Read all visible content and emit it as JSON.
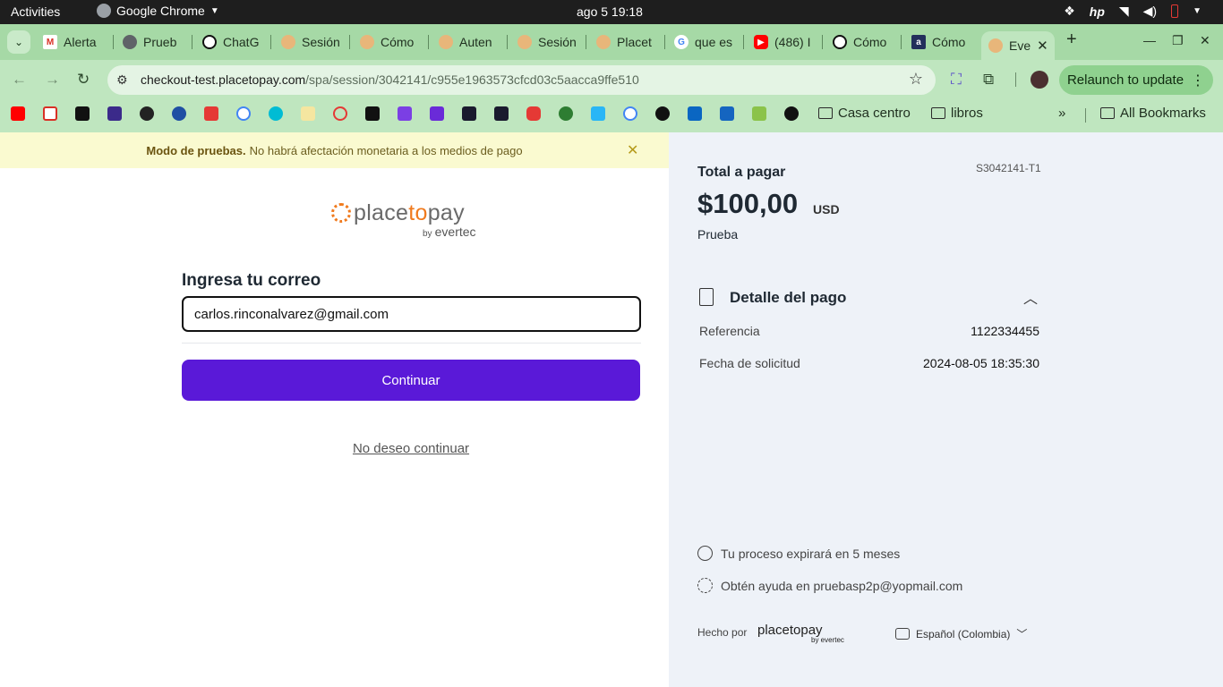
{
  "topbar": {
    "activities": "Activities",
    "app_name": "Google Chrome",
    "clock": "ago 5  19:18"
  },
  "tabs": [
    {
      "label": "Alerta",
      "color": "#d93025"
    },
    {
      "label": "Prueb",
      "color": "#5f6368"
    },
    {
      "label": "ChatG",
      "color": "#111111"
    },
    {
      "label": "Sesión",
      "color": "#f07a1d"
    },
    {
      "label": "Cómo",
      "color": "#f07a1d"
    },
    {
      "label": "Auten",
      "color": "#f07a1d"
    },
    {
      "label": "Sesión",
      "color": "#f07a1d"
    },
    {
      "label": "Placet",
      "color": "#f07a1d"
    },
    {
      "label": "que es",
      "color": "#4285f4"
    },
    {
      "label": "(486) I",
      "color": "#ff0000"
    },
    {
      "label": "Cómo",
      "color": "#111111"
    },
    {
      "label": "Cómo",
      "color": "#232f5b"
    },
    {
      "label": "Eve",
      "color": "#f07a1d"
    }
  ],
  "omnibox": {
    "host": "checkout-test.placetopay.com",
    "path": "/spa/session/3042141/c955e1963573cfcd03c5aacca9ffe510"
  },
  "relaunch_label": "Relaunch to update",
  "bookmarks": {
    "folders": [
      "Casa centro",
      "libros"
    ],
    "all_label": "All Bookmarks"
  },
  "banner": {
    "bold": "Modo de pruebas.",
    "text": "No habrá afectación monetaria a los medios de pago"
  },
  "logo": {
    "place": "place",
    "to": "to",
    "pay": "pay",
    "by": "by",
    "evertec": "evertec"
  },
  "form": {
    "label": "Ingresa tu correo",
    "email": "carlos.rinconalvarez@gmail.com",
    "continue": "Continuar",
    "cancel": "No deseo continuar"
  },
  "summary": {
    "total_label": "Total a pagar",
    "reference_code": "S3042141-T1",
    "amount": "$100,00",
    "currency": "USD",
    "description": "Prueba",
    "detail_title": "Detalle del pago",
    "rows": [
      {
        "label": "Referencia",
        "value": "1122334455"
      },
      {
        "label": "Fecha de solicitud",
        "value": "2024-08-05 18:35:30"
      }
    ],
    "expiry": "Tu proceso expirará en 5 meses",
    "help": "Obtén ayuda en pruebasp2p@yopmail.com",
    "made_by": "Hecho por",
    "made_logo": "placetopay",
    "made_logo_by": "by evertec",
    "language": "Español (Colombia)"
  }
}
